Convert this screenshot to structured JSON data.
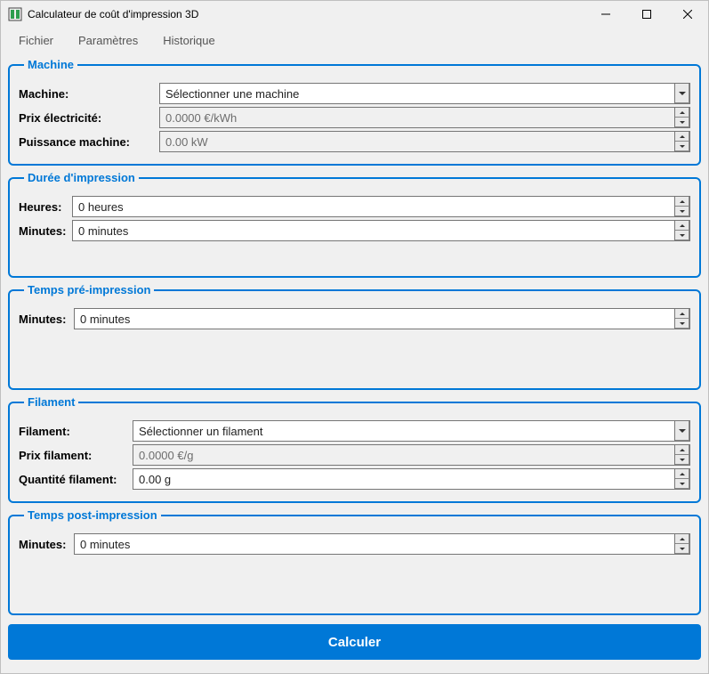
{
  "window": {
    "title": "Calculateur de coût d'impression 3D"
  },
  "menu": {
    "file": "Fichier",
    "settings": "Paramètres",
    "history": "Historique"
  },
  "machine": {
    "legend": "Machine",
    "machine_label": "Machine:",
    "machine_value": "Sélectionner une machine",
    "price_label": "Prix électricité:",
    "price_value": "0.0000 €/kWh",
    "power_label": "Puissance machine:",
    "power_value": "0.00 kW"
  },
  "duration": {
    "legend": "Durée d'impression",
    "hours_label": "Heures:",
    "hours_value": "0 heures",
    "minutes_label": "Minutes:",
    "minutes_value": "0 minutes"
  },
  "preprint": {
    "legend": "Temps pré-impression",
    "minutes_label": "Minutes:",
    "minutes_value": "0 minutes"
  },
  "filament": {
    "legend": "Filament",
    "filament_label": "Filament:",
    "filament_value": "Sélectionner un filament",
    "price_label": "Prix filament:",
    "price_value": "0.0000 €/g",
    "qty_label": "Quantité filament:",
    "qty_value": "0.00 g"
  },
  "postprint": {
    "legend": "Temps post-impression",
    "minutes_label": "Minutes:",
    "minutes_value": "0 minutes"
  },
  "calc_button": "Calculer"
}
